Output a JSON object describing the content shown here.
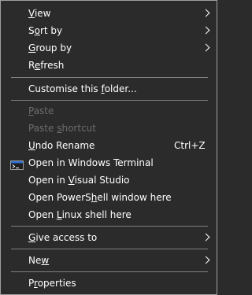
{
  "menu": {
    "view": {
      "pre": "",
      "u": "V",
      "post": "iew"
    },
    "sort_by": {
      "pre": "S",
      "u": "o",
      "post": "rt by"
    },
    "group_by": {
      "pre": "",
      "u": "G",
      "post": "roup by"
    },
    "refresh": {
      "pre": "R",
      "u": "e",
      "post": "fresh"
    },
    "customise": {
      "pre": "Customise this ",
      "u": "f",
      "post": "older..."
    },
    "paste": {
      "pre": "",
      "u": "P",
      "post": "aste"
    },
    "paste_shortcut": {
      "pre": "Paste ",
      "u": "s",
      "post": "hortcut"
    },
    "undo_rename": {
      "pre": "",
      "u": "U",
      "post": "ndo Rename"
    },
    "undo_shortcut": "Ctrl+Z",
    "terminal": "Open in Windows Terminal",
    "terminal_icon": "terminal-icon",
    "visual_studio": {
      "pre": "Open in ",
      "u": "V",
      "post": "isual Studio"
    },
    "powershell": {
      "pre": "Open PowerS",
      "u": "h",
      "post": "ell window here"
    },
    "linux_shell": {
      "pre": "Open ",
      "u": "L",
      "post": "inux shell here"
    },
    "give_access": {
      "pre": "",
      "u": "G",
      "post": "ive access to"
    },
    "new": {
      "pre": "Ne",
      "u": "w",
      "post": ""
    },
    "properties": {
      "pre": "P",
      "u": "r",
      "post": "operties"
    }
  },
  "colors": {
    "background": "#2b2b2b",
    "text": "#ffffff",
    "disabled_text": "#6d6d6d",
    "separator": "#808080",
    "border": "#a0a0a0",
    "terminal_icon_blue": "#2d6fd2"
  }
}
